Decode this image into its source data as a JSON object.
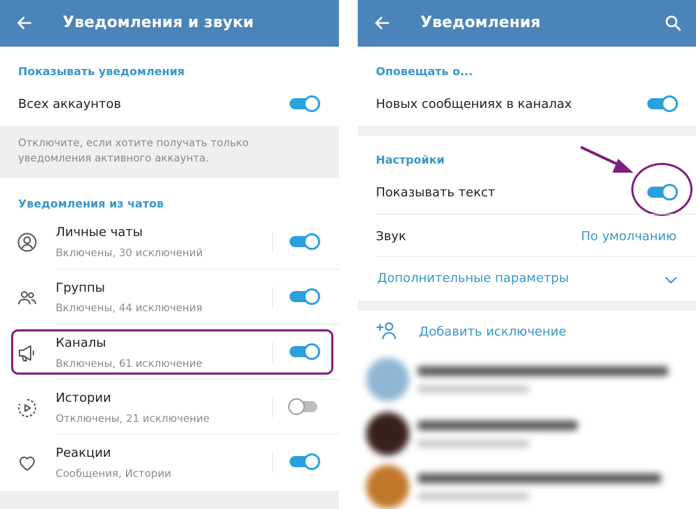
{
  "left_screen": {
    "title": "Уведомления и звуки",
    "section_show": "Показывать уведомления",
    "all_accounts_label": "Всех аккаунтов",
    "all_accounts_on": true,
    "hint": "Отключите, если хотите получать только уведомления активного аккаунта.",
    "section_chats": "Уведомления из чатов",
    "items": [
      {
        "label": "Личные чаты",
        "sub": "Включены, 30 исключений",
        "icon": "user-circle-icon",
        "on": true
      },
      {
        "label": "Группы",
        "sub": "Включены, 44 исключения",
        "icon": "group-icon",
        "on": true
      },
      {
        "label": "Каналы",
        "sub": "Включены, 61 исключение",
        "icon": "megaphone-icon",
        "on": true
      },
      {
        "label": "Истории",
        "sub": "Отключены, 21 исключение",
        "icon": "stories-icon",
        "on": false
      },
      {
        "label": "Реакции",
        "sub": "Сообщения, Истории",
        "icon": "heart-icon",
        "on": true
      }
    ]
  },
  "right_screen": {
    "title": "Уведомления",
    "section_notify": "Оповещать о...",
    "new_messages_label": "Новых сообщениях в каналах",
    "new_messages_on": true,
    "section_settings": "Настройки",
    "show_text_label": "Показывать текст",
    "show_text_on": true,
    "sound_label": "Звук",
    "sound_value": "По умолчанию",
    "advanced_label": "Дополнительные параметры",
    "add_exception_label": "Добавить исключение"
  },
  "colors": {
    "app_bar": "#4b84b8",
    "accent": "#3a97c9",
    "toggle_on": "#2aa1dd",
    "highlight": "#7e1e7e"
  }
}
